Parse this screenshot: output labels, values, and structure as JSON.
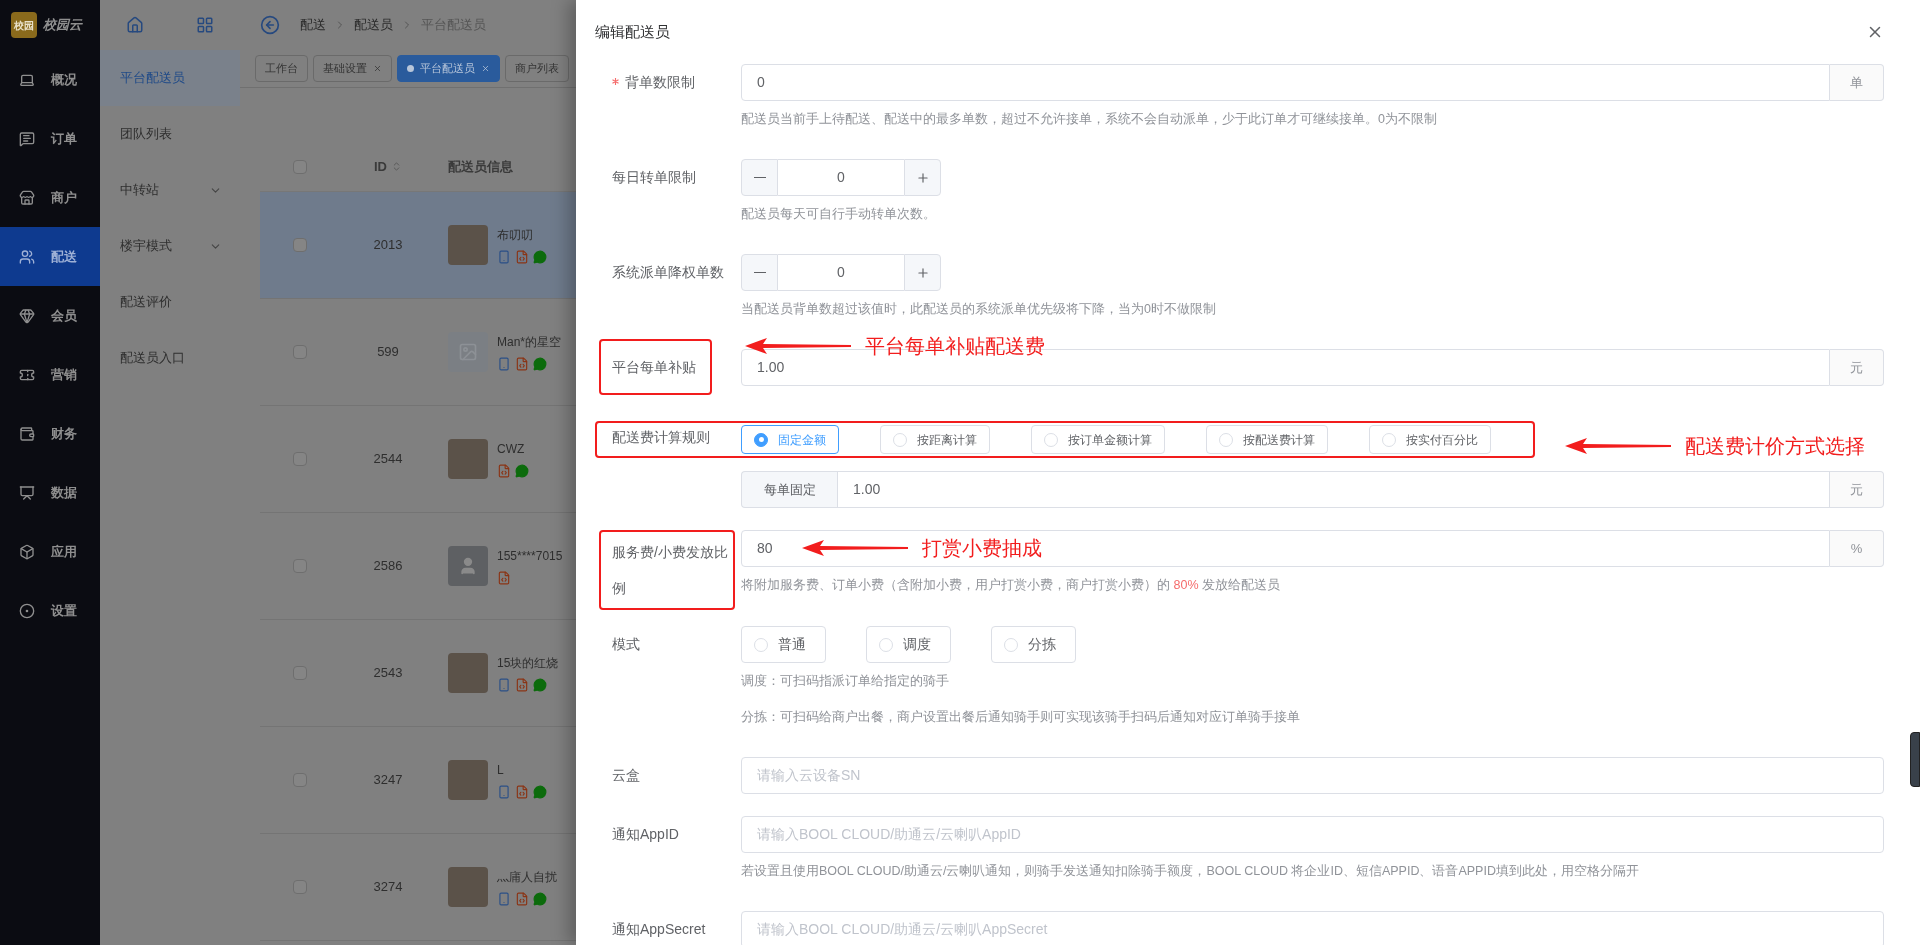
{
  "brand": {
    "badge": "校园",
    "name": "校园云"
  },
  "main_nav": [
    {
      "label": "概况",
      "selected": false
    },
    {
      "label": "订单",
      "selected": false
    },
    {
      "label": "商户",
      "selected": false
    },
    {
      "label": "配送",
      "selected": true
    },
    {
      "label": "会员",
      "selected": false
    },
    {
      "label": "营销",
      "selected": false
    },
    {
      "label": "财务",
      "selected": false
    },
    {
      "label": "数据",
      "selected": false
    },
    {
      "label": "应用",
      "selected": false
    },
    {
      "label": "设置",
      "selected": false
    }
  ],
  "sub_nav": [
    {
      "label": "平台配送员",
      "selected": true,
      "expandable": false
    },
    {
      "label": "团队列表",
      "selected": false,
      "expandable": false
    },
    {
      "label": "中转站",
      "selected": false,
      "expandable": true
    },
    {
      "label": "楼宇模式",
      "selected": false,
      "expandable": true
    },
    {
      "label": "配送评价",
      "selected": false,
      "expandable": false
    },
    {
      "label": "配送员入口",
      "selected": false,
      "expandable": false
    }
  ],
  "breadcrumb": [
    "配送",
    "配送员",
    "平台配送员"
  ],
  "tabs": [
    {
      "label": "工作台",
      "selected": false,
      "closable": false
    },
    {
      "label": "基础设置",
      "selected": false,
      "closable": true
    },
    {
      "label": "平台配送员",
      "selected": true,
      "closable": true
    },
    {
      "label": "商户列表",
      "selected": false,
      "closable": false
    }
  ],
  "table": {
    "columns": [
      "ID",
      "配送员信息"
    ],
    "all_checked": false,
    "rows": [
      {
        "id": "2013",
        "name": "布叨叨",
        "checked": false,
        "highlighted": true,
        "avatar": {
          "kind": "photo"
        },
        "platforms": [
          {
            "kind": "app"
          },
          {
            "kind": "h5"
          },
          {
            "kind": "wechat"
          }
        ]
      },
      {
        "id": "599",
        "name": "Man*的星空",
        "checked": false,
        "highlighted": false,
        "avatar": {
          "kind": "placeholder"
        },
        "platforms": [
          {
            "kind": "app"
          },
          {
            "kind": "h5"
          },
          {
            "kind": "wechat"
          }
        ]
      },
      {
        "id": "2544",
        "name": "CWZ",
        "checked": false,
        "highlighted": false,
        "avatar": {
          "kind": "photo"
        },
        "platforms": [
          {
            "kind": "h5"
          },
          {
            "kind": "wechat"
          }
        ]
      },
      {
        "id": "2586",
        "name": "155****7015",
        "checked": false,
        "highlighted": false,
        "avatar": {
          "kind": "default"
        },
        "platforms": [
          {
            "kind": "h5"
          }
        ]
      },
      {
        "id": "2543",
        "name": "15块的红烧",
        "checked": false,
        "highlighted": false,
        "avatar": {
          "kind": "photo"
        },
        "platforms": [
          {
            "kind": "app"
          },
          {
            "kind": "h5"
          },
          {
            "kind": "wechat"
          }
        ]
      },
      {
        "id": "3247",
        "name": "L",
        "checked": false,
        "highlighted": false,
        "avatar": {
          "kind": "photo"
        },
        "platforms": [
          {
            "kind": "app"
          },
          {
            "kind": "h5"
          },
          {
            "kind": "wechat"
          }
        ]
      },
      {
        "id": "3274",
        "name": "灬庯人自扰",
        "checked": false,
        "highlighted": false,
        "avatar": {
          "kind": "photo"
        },
        "platforms": [
          {
            "kind": "app"
          },
          {
            "kind": "h5"
          },
          {
            "kind": "wechat"
          }
        ]
      }
    ]
  },
  "drawer": {
    "title": "编辑配送员",
    "fields": [
      {
        "kind": "input",
        "label": "背单数限制",
        "required": true,
        "value": "0",
        "suffix": "单",
        "hints": [
          "配送员当前手上待配送、配送中的最多单数，超过不允许接单，系统不会自动派单，少于此订单才可继续接单。0为不限制"
        ]
      },
      {
        "kind": "stepper",
        "label": "每日转单限制",
        "required": false,
        "value": "0",
        "hints": [
          "配送员每天可自行手动转单次数。"
        ]
      },
      {
        "kind": "stepper",
        "label": "系统派单降权单数",
        "required": false,
        "value": "0",
        "hints": [
          "当配送员背单数超过该值时，此配送员的系统派单优先级将下降，当为0时不做限制"
        ]
      },
      {
        "kind": "input",
        "label": "平台每单补贴",
        "required": false,
        "value": "1.00",
        "suffix": "元",
        "highlighted": true,
        "callout": "平台每单补贴配送费"
      },
      {
        "kind": "radio",
        "label": "配送费计算规则",
        "required": false,
        "highlighted": true,
        "callout": "配送费计价方式选择",
        "options": [
          {
            "label": "固定金额",
            "selected": true
          },
          {
            "label": "按距离计算",
            "selected": false
          },
          {
            "label": "按订单金额计算",
            "selected": false
          },
          {
            "label": "按配送费计算",
            "selected": false
          },
          {
            "label": "按实付百分比",
            "selected": false
          }
        ]
      },
      {
        "kind": "input",
        "prefix": "每单固定",
        "required": false,
        "value": "1.00",
        "suffix": "元"
      },
      {
        "kind": "input",
        "label": "服务费/小费发放比例",
        "required": false,
        "value": "80",
        "suffix": "%",
        "highlighted": true,
        "callout": "打赏小费抽成",
        "hint_parts": [
          {
            "text": "将附加服务费、订单小费（含附加小费，用户打赏小费，商户打赏小费）的 ",
            "emphasis": false
          },
          {
            "text": "80%",
            "emphasis": true
          },
          {
            "text": " 发放给配送员",
            "emphasis": false
          }
        ]
      },
      {
        "kind": "radio",
        "label": "模式",
        "required": false,
        "options": [
          {
            "label": "普通",
            "selected": false
          },
          {
            "label": "调度",
            "selected": false
          },
          {
            "label": "分拣",
            "selected": false
          }
        ],
        "hints": [
          "调度：可扫码指派订单给指定的骑手",
          "分拣：可扫码给商户出餐，商户设置出餐后通知骑手则可实现该骑手扫码后通知对应订单骑手接单"
        ]
      },
      {
        "kind": "input",
        "label": "云盒",
        "required": false,
        "placeholder": "请输入云设备SN"
      },
      {
        "kind": "input",
        "label": "通知AppID",
        "required": false,
        "placeholder": "请输入BOOL CLOUD/助通云/云喇叭AppID",
        "hints": [
          "若设置且使用BOOL CLOUD/助通云/云喇叭通知，则骑手发送通知扣除骑手额度，BOOL CLOUD 将企业ID、短信APPID、语音APPID填到此处，用空格分隔开"
        ]
      },
      {
        "kind": "input",
        "label": "通知AppSecret",
        "required": false,
        "placeholder": "请输入BOOL CLOUD/助通云/云喇叭AppSecret"
      }
    ]
  }
}
